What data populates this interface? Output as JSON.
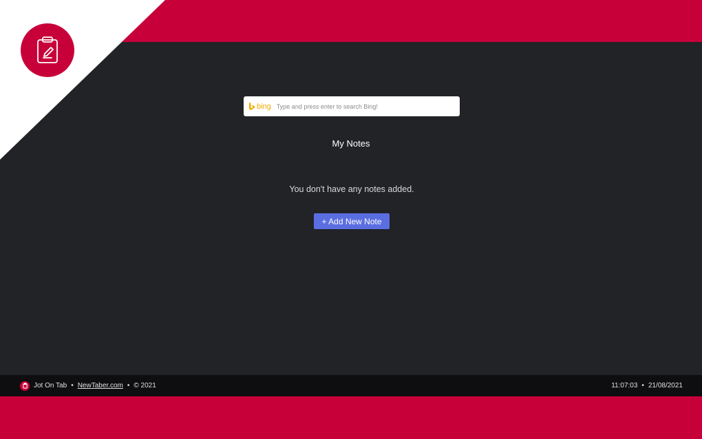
{
  "brand": {
    "logo_icon": "clipboard-edit-icon",
    "accent_color": "#c8003a",
    "name": "Jot On Tab"
  },
  "search": {
    "engine_label": "bing",
    "placeholder": "Type and press enter to search Bing!",
    "value": ""
  },
  "notes": {
    "title": "My Notes",
    "empty_message": "You don't have any notes added.",
    "add_button_label": "+ Add New Note",
    "button_color": "#5b6ee1"
  },
  "footer": {
    "app_name": "Jot On Tab",
    "separator": "•",
    "site_link": "NewTaber.com",
    "copyright": "© 2021",
    "time": "11:07:03",
    "date": "21/08/2021"
  }
}
